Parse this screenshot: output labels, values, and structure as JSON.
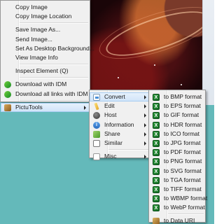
{
  "main_menu": {
    "items": [
      {
        "label": "Copy Image"
      },
      {
        "label": "Copy Image Location"
      },
      {
        "label": "Save Image As..."
      },
      {
        "label": "Send Image..."
      },
      {
        "label": "Set As Desktop Background..."
      },
      {
        "label": "View Image Info"
      },
      {
        "label": "Inspect Element (Q)"
      },
      {
        "label": "Download with IDM",
        "icon": "idm-icon"
      },
      {
        "label": "Download all links with IDM",
        "icon": "idm-icon"
      },
      {
        "label": "PictuTools",
        "icon": "pictutools-icon"
      }
    ]
  },
  "pictutools_menu": {
    "items": [
      {
        "label": "Convert",
        "icon": "convert-icon"
      },
      {
        "label": "Edit",
        "icon": "edit-pencil-icon"
      },
      {
        "label": "Host",
        "icon": "host-icon"
      },
      {
        "label": "Information",
        "icon": "info-icon"
      },
      {
        "label": "Share",
        "icon": "share-icon"
      },
      {
        "label": "Similar",
        "icon": "similar-icon"
      },
      {
        "label": "Misc",
        "icon": "misc-icon"
      }
    ]
  },
  "convert_menu": {
    "items": [
      {
        "label": "to BMP format"
      },
      {
        "label": "to EPS format"
      },
      {
        "label": "to GIF format"
      },
      {
        "label": "to HDR format"
      },
      {
        "label": "to ICO format"
      },
      {
        "label": "to JPG format"
      },
      {
        "label": "to PDF format"
      },
      {
        "label": "to PNG format"
      },
      {
        "label": "to SVG format"
      },
      {
        "label": "to TGA format"
      },
      {
        "label": "to TIFF format"
      },
      {
        "label": "to WBMP format"
      },
      {
        "label": "to WebP format"
      },
      {
        "label": "to Data URI"
      }
    ]
  },
  "icon_glyphs": {
    "convert_x": "X",
    "info": "i"
  },
  "colors": {
    "desktop_background": "#64b9ba",
    "menu_background": "#f0f0f0",
    "highlight": "#cfe3f8"
  }
}
